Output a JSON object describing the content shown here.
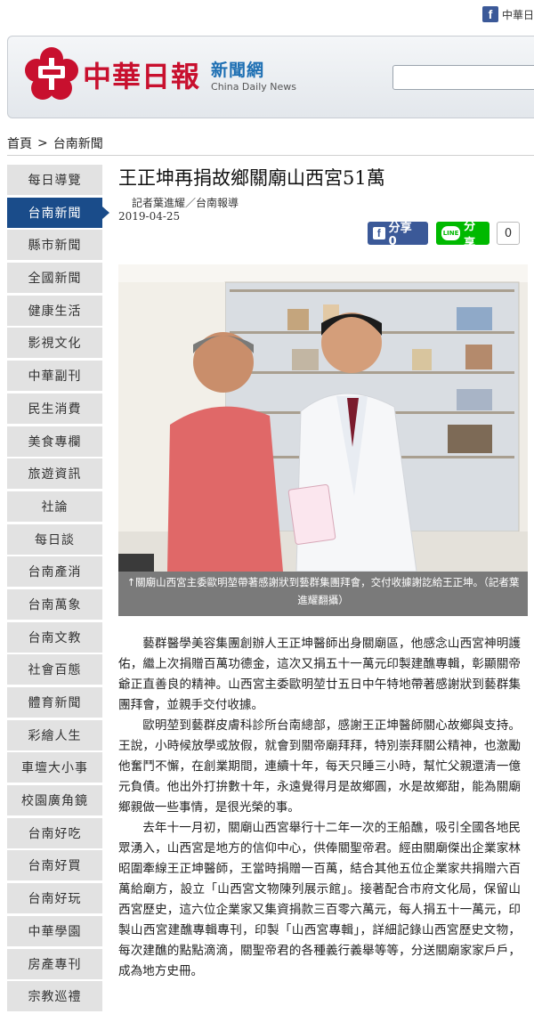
{
  "topbar": {
    "fb_label": "中華日",
    "fb_icon": "facebook-icon"
  },
  "header": {
    "logo_text": "中華日報",
    "logo_sub_cn": "新聞網",
    "logo_sub_en": "China Daily News",
    "brand_red": "#c8102e",
    "brand_blue": "#1d6fb3"
  },
  "breadcrumb": {
    "home": "首頁",
    "sep": ">",
    "current": "台南新聞"
  },
  "sidebar": {
    "items": [
      {
        "label": "每日導覽"
      },
      {
        "label": "台南新聞",
        "active": true
      },
      {
        "label": "縣市新聞"
      },
      {
        "label": "全國新聞"
      },
      {
        "label": "健康生活"
      },
      {
        "label": "影視文化"
      },
      {
        "label": "中華副刊"
      },
      {
        "label": "民生消費"
      },
      {
        "label": "美食專欄"
      },
      {
        "label": "旅遊資訊"
      },
      {
        "label": "社論"
      },
      {
        "label": "每日談"
      },
      {
        "label": "台南產消"
      },
      {
        "label": "台南萬象"
      },
      {
        "label": "台南文教"
      },
      {
        "label": "社會百態"
      },
      {
        "label": "體育新聞"
      },
      {
        "label": "彩繪人生"
      },
      {
        "label": "車壇大小事"
      },
      {
        "label": "校園廣角鏡"
      },
      {
        "label": "台南好吃"
      },
      {
        "label": "台南好買"
      },
      {
        "label": "台南好玩"
      },
      {
        "label": "中華學園"
      },
      {
        "label": "房產專刊"
      },
      {
        "label": "宗教巡禮"
      }
    ],
    "active_color": "#1a4c8a"
  },
  "article": {
    "title": "王正坤再捐故鄉關廟山西宮51萬",
    "byline": "記者葉進耀／台南報導",
    "date": "2019-04-25",
    "share_fb": "分享 0",
    "share_line": "分享",
    "share_line_badge": "LINE",
    "share_count": "0",
    "caption": "↑關廟山西宮主委歐明堃帶著感謝狀到藝群集團拜會，交付收據謝訖給王正坤。（記者葉進耀翻攝）",
    "paragraphs": [
      "藝群醫學美容集團創辦人王正坤醫師出身關廟區，他感念山西宮神明護佑，繼上次捐贈百萬功德金，這次又捐五十一萬元印製建醮專輯，彰顯關帝爺正直善良的精神。山西宮主委歐明堃廿五日中午特地帶著感謝狀到藝群集團拜會，並親手交付收據。",
      "歐明堃到藝群皮膚科診所台南總部，感謝王正坤醫師關心故鄉與支持。王說，小時候放學或放假，就會到關帝廟拜拜，特別崇拜關公精神，也激勵他奮鬥不懈，在創業期間，連續十年，每天只睡三小時，幫忙父親還清一億元負債。他出外打拚數十年，永遠覺得月是故鄉圓，水是故鄉甜，能為關廟鄉親做一些事情，是很光榮的事。",
      "去年十一月初，關廟山西宮舉行十二年一次的王船醮，吸引全國各地民眾湧入，山西宮是地方的信仰中心，供俸關聖帝君。經由關廟傑出企業家林昭圍牽線王正坤醫師，王當時捐贈一百萬，結合其他五位企業家共捐贈六百萬給廟方，設立「山西宮文物陳列展示館」。接著配合市府文化局，保留山西宮歷史，這六位企業家又集資捐款三百零六萬元，每人捐五十一萬元，印製山西宮建醮專輯專刊，印製「山西宮專輯」，詳細記錄山西宮歷史文物，每次建醮的點點滴滴，關聖帝君的各種義行義舉等等，分送關廟家家戶戶，成為地方史冊。"
    ]
  }
}
